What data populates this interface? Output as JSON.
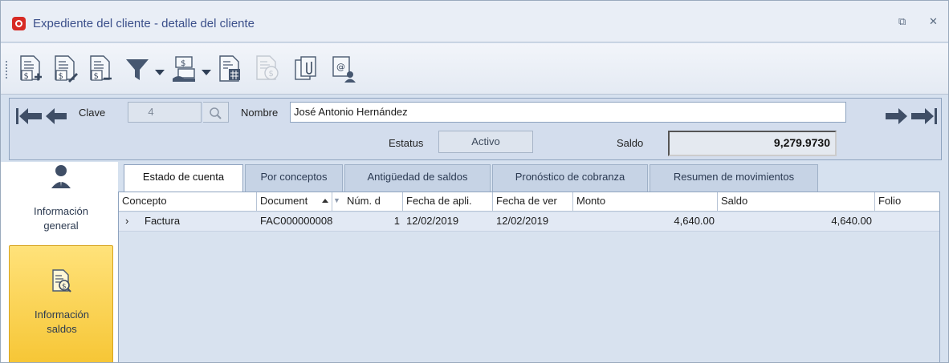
{
  "window": {
    "title": "Expediente del cliente - detalle del cliente",
    "restore_glyph": "⧉",
    "close_glyph": "✕"
  },
  "toolbar": {
    "buttons": [
      {
        "icon": "new-document-dollar-icon"
      },
      {
        "icon": "edit-document-dollar-icon"
      },
      {
        "icon": "delete-document-dollar-icon"
      },
      {
        "icon": "filter-icon",
        "dropdown": true
      },
      {
        "icon": "payment-icon",
        "dropdown": true
      },
      {
        "icon": "calendar-report-icon"
      },
      {
        "icon": "currency-exchange-icon",
        "disabled": true
      },
      {
        "icon": "attachment-icon"
      },
      {
        "icon": "email-contacts-icon"
      }
    ]
  },
  "client": {
    "clave_label": "Clave",
    "clave_value": "4",
    "nombre_label": "Nombre",
    "nombre_value": "José Antonio Hernández",
    "estatus_label": "Estatus",
    "estatus_value": "Activo",
    "saldo_label": "Saldo",
    "saldo_value": "9,279.9730"
  },
  "side": {
    "items": [
      {
        "label_line1": "Información",
        "label_line2": "general",
        "icon": "user-icon"
      },
      {
        "label_line1": "Información",
        "label_line2": "saldos",
        "icon": "document-search-icon",
        "active": true
      }
    ]
  },
  "tabs": [
    {
      "label": "Estado de cuenta",
      "active": true
    },
    {
      "label": "Por conceptos"
    },
    {
      "label": "Antigüedad de saldos"
    },
    {
      "label": "Pronóstico de cobranza"
    },
    {
      "label": "Resumen de movimientos"
    }
  ],
  "grid": {
    "columns": [
      "Concepto",
      "Document",
      "Núm. d",
      "Fecha de apli.",
      "Fecha de ver",
      "Monto",
      "Saldo",
      "Folio"
    ],
    "rows": [
      {
        "expander": "›",
        "concepto": "Factura",
        "documento": "FAC000000008",
        "numero": "1",
        "fecha_aplicacion": "12/02/2019",
        "fecha_vencimiento": "12/02/2019",
        "monto": "4,640.00",
        "saldo": "4,640.00",
        "folio": ""
      }
    ]
  },
  "colors": {
    "accent_yellow": "#f6c533",
    "panel_blue": "#d3dded",
    "title_text": "#3b4f8a"
  }
}
